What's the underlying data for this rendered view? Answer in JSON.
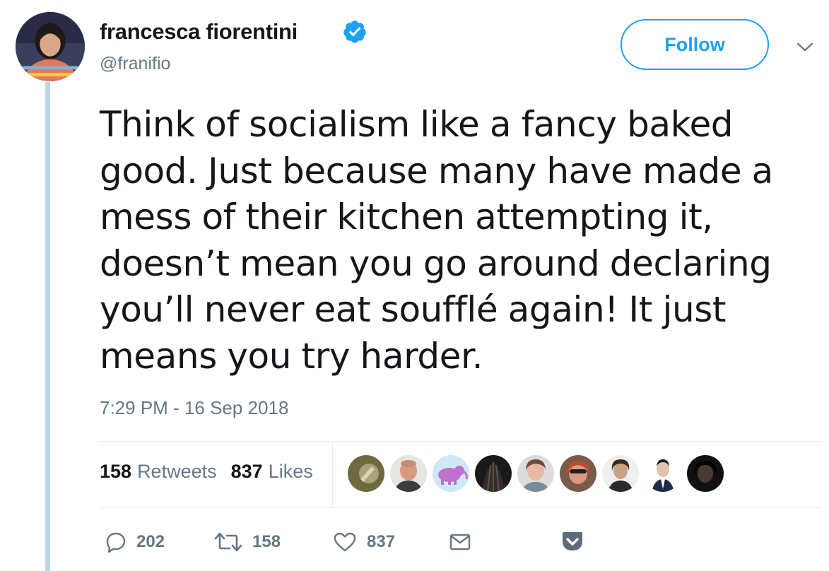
{
  "author": {
    "name": "francesca fiorentini",
    "handle": "@franifio",
    "verified": true
  },
  "follow_button": {
    "label": "Follow"
  },
  "tweet": {
    "text": "Think of socialism like a fancy baked\ngood. Just because many have made a\nmess of their kitchen attempting it,\ndoesn’t mean you go around declaring\nyou’ll never eat soufflé again! It just\nmeans you try harder.",
    "timestamp": "7:29 PM - 16 Sep 2018"
  },
  "stats": {
    "retweets_count": "158",
    "retweets_label": "Retweets",
    "likes_count": "837",
    "likes_label": "Likes"
  },
  "actions": {
    "reply_count": "202",
    "retweet_count": "158",
    "like_count": "837"
  },
  "icons": {
    "verified": "verified-badge-icon",
    "more": "chevron-down-icon",
    "reply": "reply-bubble-icon",
    "retweet": "retweet-arrows-icon",
    "like": "heart-icon",
    "message": "envelope-icon",
    "pocket": "pocket-icon"
  },
  "colors": {
    "accent": "#1da1f2",
    "text": "#14171a",
    "muted": "#657786",
    "thread_line": "#b9d7e6",
    "pocket": "#5a6c7c"
  }
}
